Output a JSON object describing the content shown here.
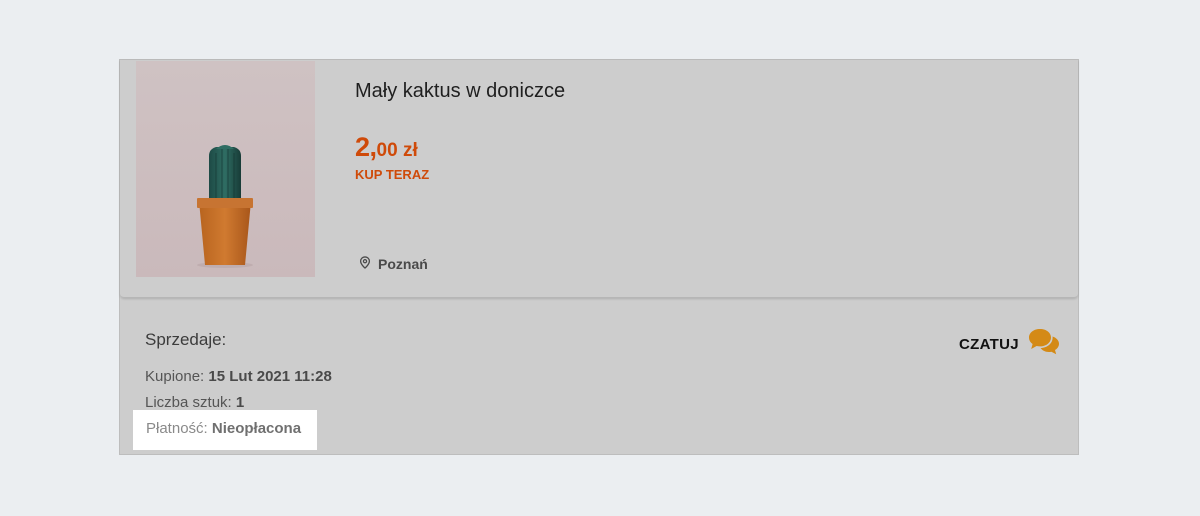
{
  "product": {
    "title": "Mały kaktus w doniczce",
    "price_main": "2,",
    "price_rest": "00 zł",
    "buy_type": "KUP TERAZ",
    "location_icon": "location-pin-icon",
    "location": "Poznań"
  },
  "seller": {
    "label": "Sprzedaje:",
    "chat_label": "CZATUJ",
    "chat_icon": "chat-bubbles-icon"
  },
  "order": {
    "bought_label": "Kupione: ",
    "bought_value": "15 Lut 2021 11:28",
    "qty_label": "Liczba sztuk: ",
    "qty_value": "1",
    "payment_label": "Płatność: ",
    "payment_value": "Nieopłacona"
  },
  "colors": {
    "accent": "#cf4a09",
    "chat_icon": "#d48a16",
    "card_bg": "#cdcdcd",
    "page_bg": "#ebeef1"
  }
}
